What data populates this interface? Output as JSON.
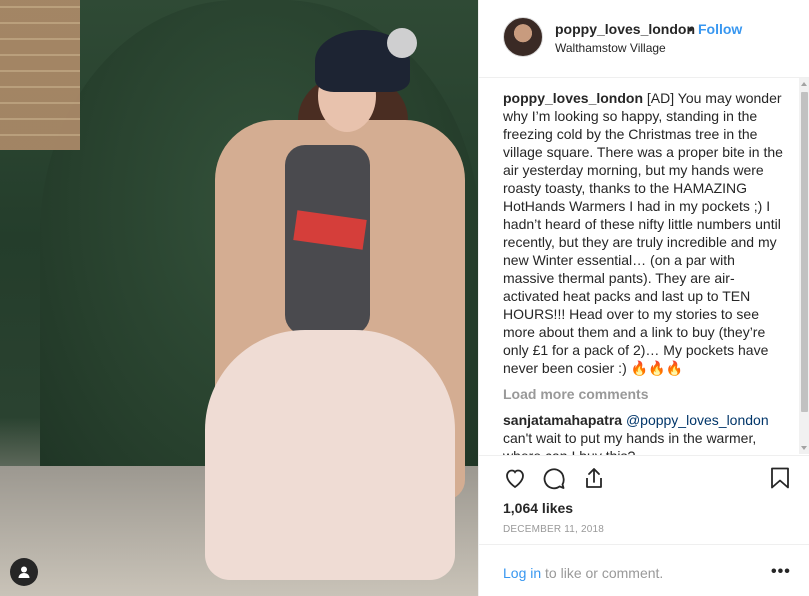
{
  "post": {
    "username": "poppy_loves_london",
    "separator": "•",
    "follow_label": "Follow",
    "location": "Walthamstow Village"
  },
  "caption": {
    "username": "poppy_loves_london",
    "text": "[AD] You may wonder why I’m looking so happy, standing in the freezing cold by the Christmas tree in the village square. There was a proper bite in the air yesterday morning, but my hands were roasty toasty, thanks to the HAMAZING HotHands Warmers I had in my pockets ;) I hadn’t heard of these nifty little numbers until recently, but they are truly incredible and my new Winter essential… (on a par with massive thermal pants). They are air-activated heat packs and last up to TEN HOURS!!! Head over to my stories to see more about them and a link to buy (they’re only £1 for a pack of 2)… My pockets have never been cosier :) ",
    "emoji": "🔥🔥🔥"
  },
  "load_more_label": "Load more comments",
  "comments": [
    {
      "username": "sanjatamahapatra",
      "mention": "@poppy_loves_london",
      "text": "can't wait to put my hands in the warmer, where can I buy this?"
    }
  ],
  "stats": {
    "likes": "1,064 likes",
    "date": "DECEMBER 11, 2018"
  },
  "footer": {
    "login_label": "Log in",
    "login_suffix": " to like or comment.",
    "more_label": "•••"
  },
  "icons": {
    "like": "heart-icon",
    "comment": "comment-icon",
    "share": "share-icon",
    "save": "bookmark-icon",
    "tag": "user-tag-icon"
  },
  "colors": {
    "accent": "#3897f0",
    "text": "#262626",
    "muted": "#999999"
  }
}
